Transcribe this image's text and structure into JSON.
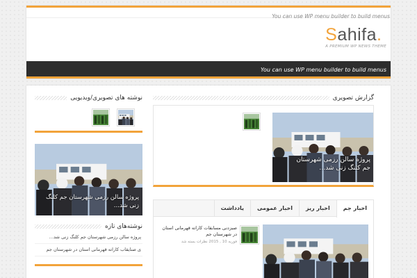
{
  "header": {
    "top_menu_text": "You can use WP menu builder to build menus",
    "logo": {
      "first_letter": "S",
      "rest": "ahifa",
      "dot": ".",
      "tagline": "A PREMIUM WP NEWS THEME"
    },
    "nav_menu_text": "You can use WP menu builder to build menus"
  },
  "gallery": {
    "title": "گزارش تصویری",
    "caption": "پروژه سالن رزمی شهرستان جم كلنگ زنی شد…"
  },
  "tabs": {
    "items": [
      "اخبار جم",
      "اخبار ریز",
      "اخبار عمومی",
      "یادداشت"
    ],
    "post_title": "صبزدنی مسابقات کاراته قهرمانی استان در شهرستان جم",
    "post_meta": "فوریه 10 , 2015 نظرات بسته شد"
  },
  "sidebar": {
    "video_title": "نوشته های تصویری/ویدیویی",
    "photo_caption": "پروژه سالن رزمی شهرستان جم كلنگ زنی شد…",
    "recent_title": "نوشته‌های تازه",
    "recent_items": [
      "پروژه سالن رزمی شهرستان جم كلنگ زنی شد…",
      "ی صنایقاب کاراته قهرمانی استان در شهرستان جم"
    ]
  },
  "colors": {
    "accent": "#f2a33a",
    "nav_bg": "#2d2d2d"
  }
}
